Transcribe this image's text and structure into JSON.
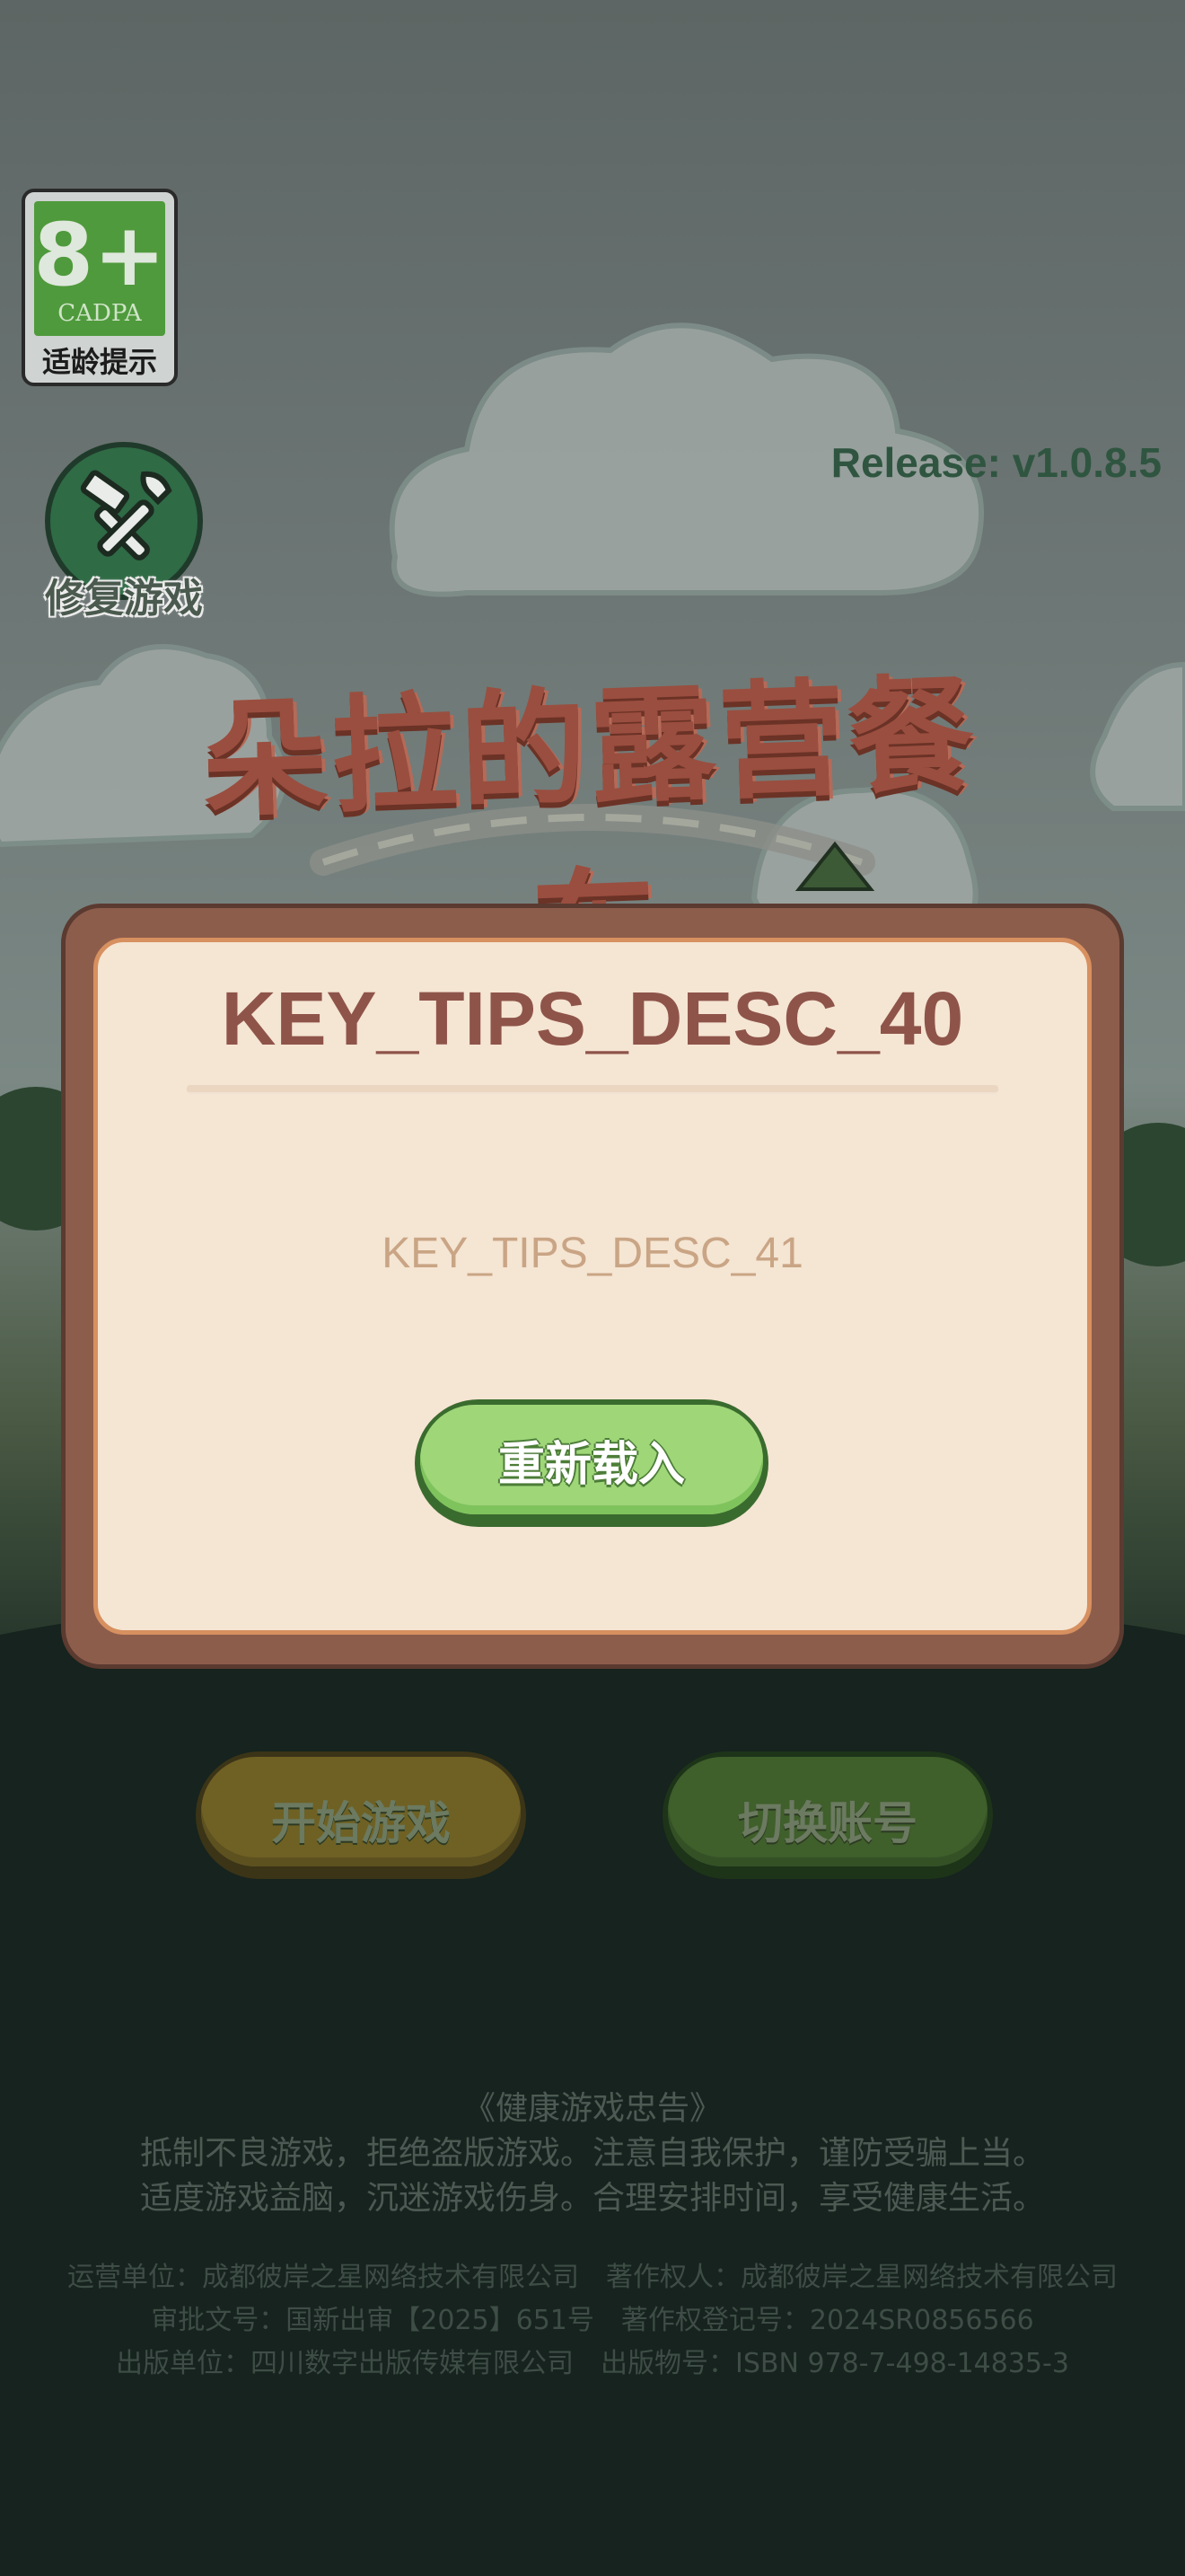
{
  "age_rating": {
    "value": "8+",
    "org": "CADPA",
    "label": "适龄提示"
  },
  "repair": {
    "label": "修复游戏",
    "icon": "wrench-hammer-icon"
  },
  "release": "Release: v1.0.8.5",
  "logo": {
    "text": "朵拉的露营餐车"
  },
  "dialog": {
    "title": "KEY_TIPS_DESC_40",
    "description": "KEY_TIPS_DESC_41",
    "reload_label": "重新载入"
  },
  "buttons": {
    "start": "开始游戏",
    "switch_account": "切换账号"
  },
  "health_advice": {
    "title": "《健康游戏忠告》",
    "line1": "抵制不良游戏，拒绝盗版游戏。注意自我保护，谨防受骗上当。",
    "line2": "适度游戏益脑，沉迷游戏伤身。合理安排时间，享受健康生活。"
  },
  "info": {
    "line1": "运营单位：成都彼岸之星网络技术有限公司　著作权人：成都彼岸之星网络技术有限公司",
    "line2": "审批文号：国新出审【2025】651号　著作权登记号：2024SR0856566",
    "line3": "出版单位：四川数字出版传媒有限公司　出版物号：ISBN 978-7-498-14835-3"
  },
  "colors": {
    "dialog_title": "#8e544a",
    "dialog_desc": "#c9a585",
    "reload_green": "#9fd678",
    "release_text": "#2f5540"
  }
}
